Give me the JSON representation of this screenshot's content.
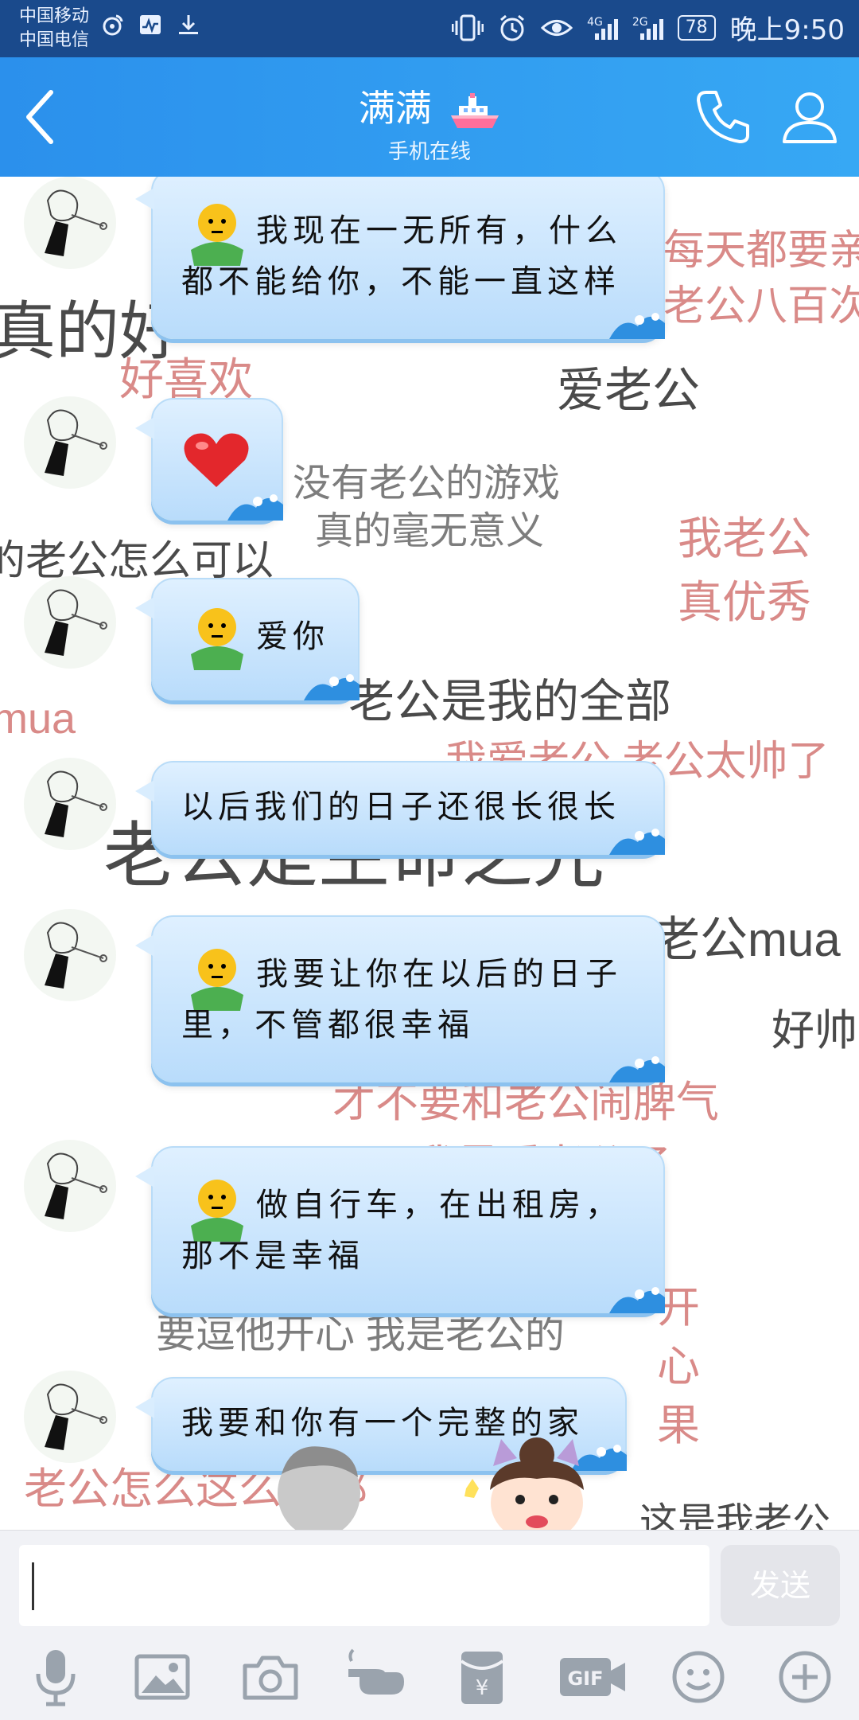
{
  "status_bar": {
    "carrier1": "中国移动",
    "carrier2": "中国电信",
    "net1": "4G",
    "net2": "2G",
    "battery": "78",
    "time": "晚上9:50"
  },
  "header": {
    "title": "满满",
    "subtitle": "手机在线"
  },
  "danmu": [
    "每天都要亲",
    "老公八百次",
    "真的好",
    "好喜欢",
    "爱老公",
    "没有老公的游戏",
    "真的毫无意义",
    "我老公",
    "真优秀",
    "的老公怎么可以",
    "老公是我的全部",
    "mua",
    "我爱老公 老公太帅了",
    "老公是生命之光",
    "老公mua",
    "好帅",
    "才不要和老公闹脾气",
    "我最爱老公了",
    "要逗他开心 我是老公的",
    "开",
    "心",
    "果",
    "老公怎么这么人都",
    "这是我老公"
  ],
  "messages": [
    {
      "text": "我现在一无所有，什么都不能给你，不能一直这样",
      "line1": "我现在一无所有，什么",
      "line2": "都不能给你，不能一直这样"
    },
    {
      "text": "❤"
    },
    {
      "text": "爱你"
    },
    {
      "text": "以后我们的日子还很长很长"
    },
    {
      "line1": "我要让你在以后的日子",
      "line2": "里，不管都很幸福"
    },
    {
      "line1": "做自行车，在出租房，",
      "line2": "那不是幸福"
    },
    {
      "text": "我要和你有一个完整的家"
    }
  ],
  "input": {
    "send_label": "发送"
  },
  "toolbar": {
    "gif_label": "GIF"
  }
}
